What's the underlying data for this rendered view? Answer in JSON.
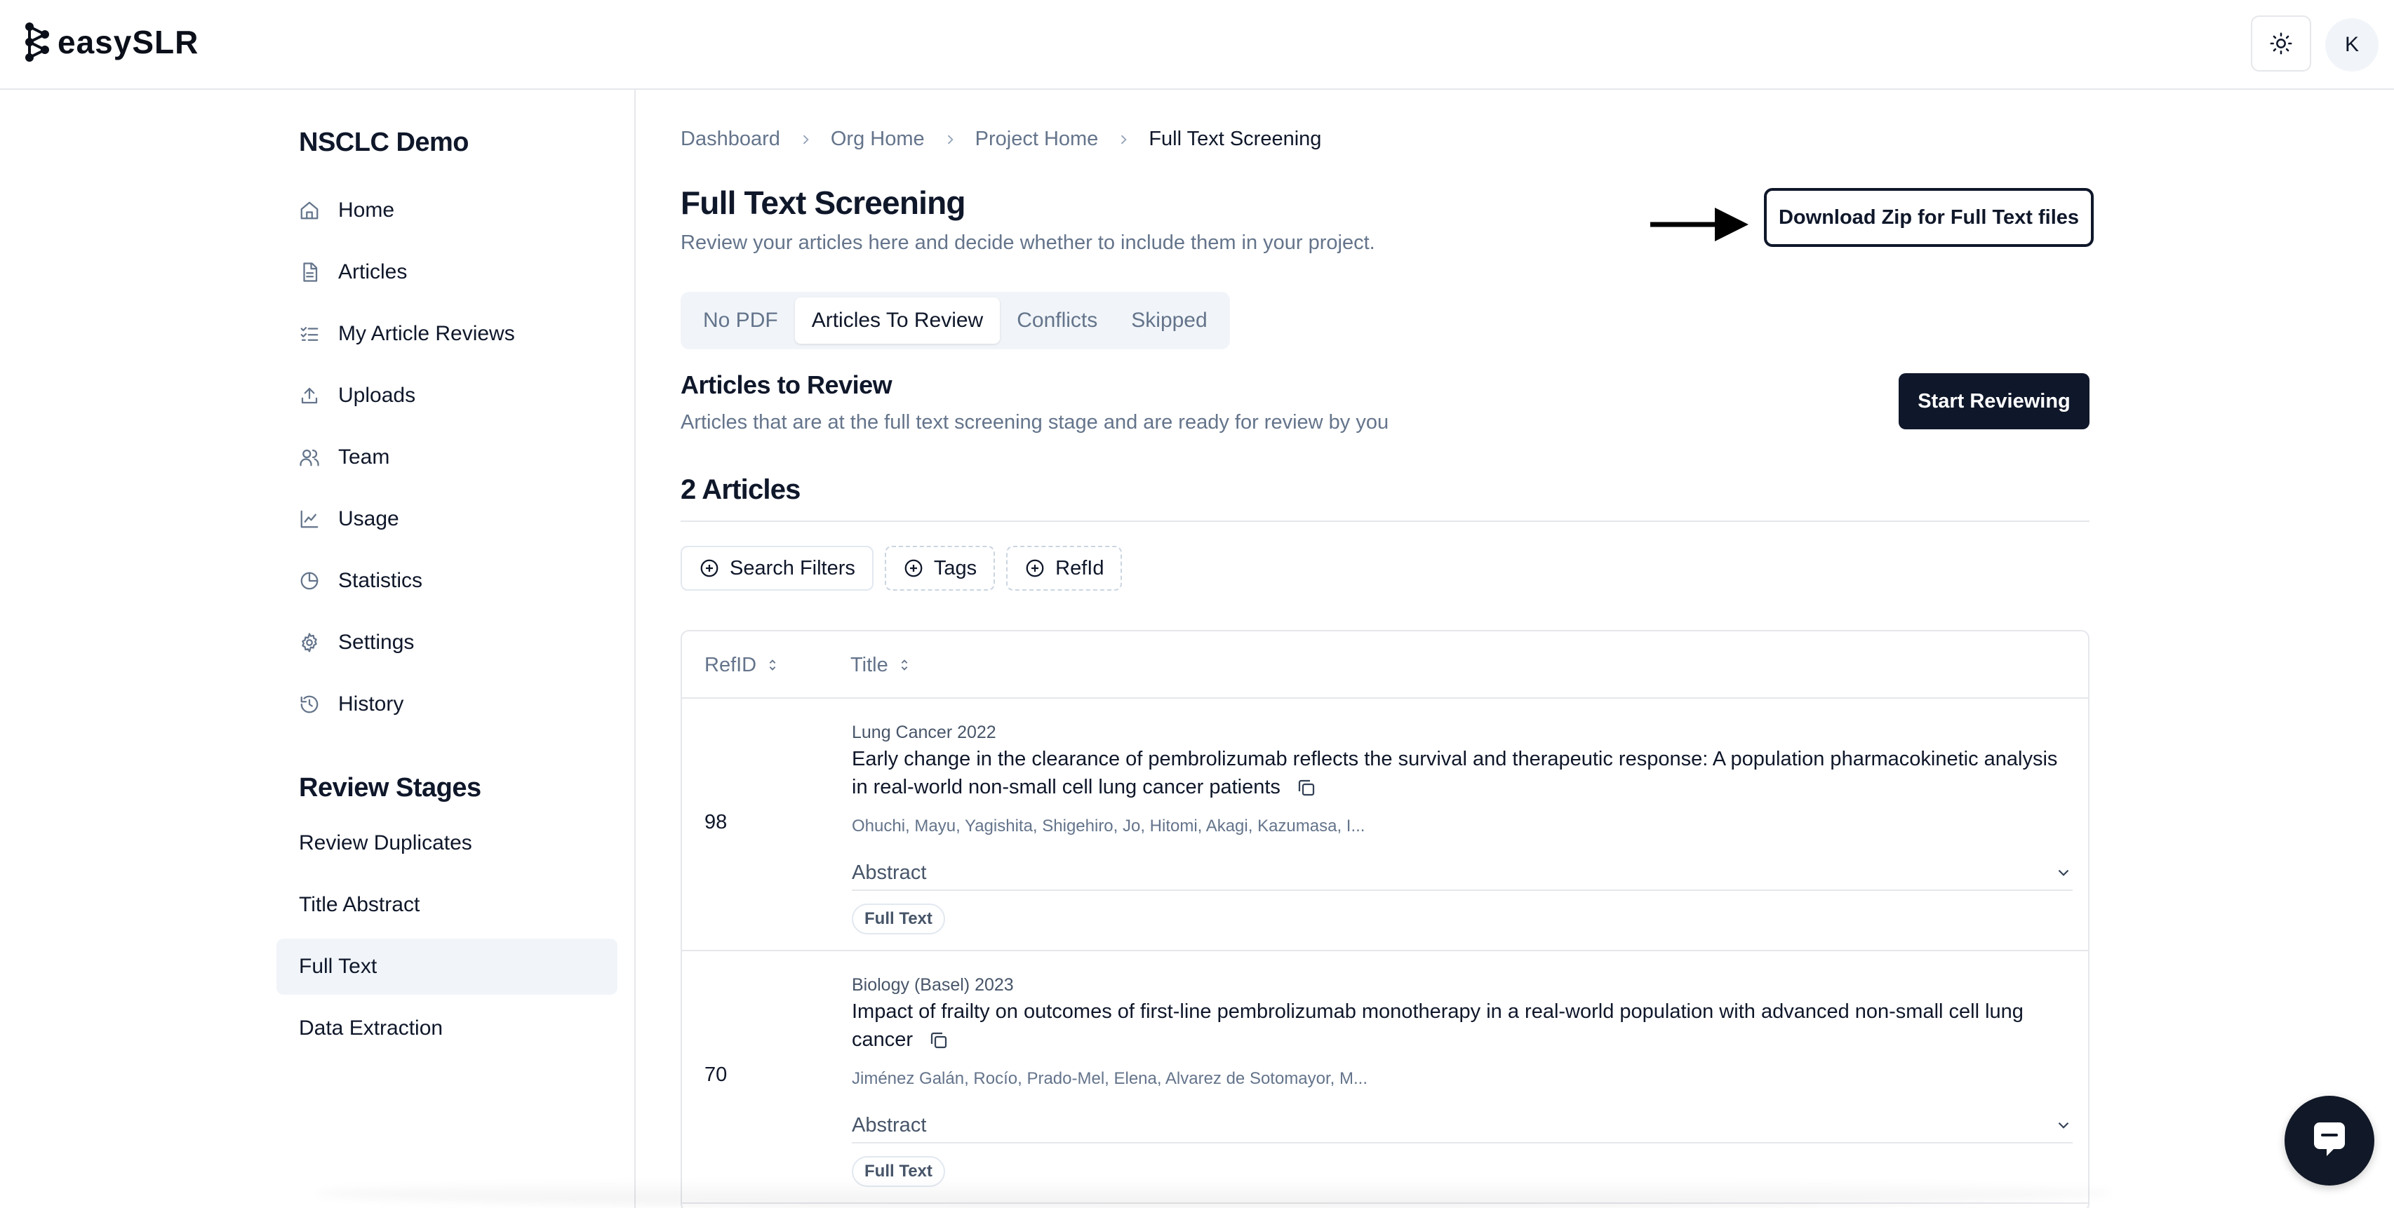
{
  "app": {
    "logo_text": "easySLR",
    "avatar_initial": "K"
  },
  "sidebar": {
    "project_name": "NSCLC Demo",
    "items": [
      {
        "label": "Home",
        "icon": "home-icon"
      },
      {
        "label": "Articles",
        "icon": "document-icon"
      },
      {
        "label": "My Article Reviews",
        "icon": "list-check-icon"
      },
      {
        "label": "Uploads",
        "icon": "upload-icon"
      },
      {
        "label": "Team",
        "icon": "users-icon"
      },
      {
        "label": "Usage",
        "icon": "line-chart-icon"
      },
      {
        "label": "Statistics",
        "icon": "pie-chart-icon"
      },
      {
        "label": "Settings",
        "icon": "gear-icon"
      },
      {
        "label": "History",
        "icon": "history-icon"
      }
    ],
    "stages_title": "Review Stages",
    "stages": [
      {
        "label": "Review Duplicates",
        "active": false
      },
      {
        "label": "Title Abstract",
        "active": false
      },
      {
        "label": "Full Text",
        "active": true
      },
      {
        "label": "Data Extraction",
        "active": false
      }
    ]
  },
  "breadcrumb": [
    "Dashboard",
    "Org Home",
    "Project Home",
    "Full Text Screening"
  ],
  "header": {
    "title": "Full Text Screening",
    "subtitle": "Review your articles here and decide whether to include them in your project.",
    "download_label": "Download Zip for Full Text files"
  },
  "tabs": [
    {
      "label": "No PDF",
      "active": false
    },
    {
      "label": "Articles To Review",
      "active": true
    },
    {
      "label": "Conflicts",
      "active": false
    },
    {
      "label": "Skipped",
      "active": false
    }
  ],
  "section": {
    "title": "Articles to Review",
    "subtitle": "Articles that are at the full text screening stage and are ready for review by you",
    "start_label": "Start Reviewing",
    "count_label": "2 Articles"
  },
  "filters": [
    "Search Filters",
    "Tags",
    "RefId"
  ],
  "table": {
    "columns": [
      "RefID",
      "Title"
    ],
    "rows": [
      {
        "refid": "98",
        "journal": "Lung Cancer 2022",
        "title": "Early change in the clearance of pembrolizumab reflects the survival and therapeutic response: A population pharmacokinetic analysis in real-world non-small cell lung cancer patients",
        "authors": "Ohuchi, Mayu, Yagishita, Shigehiro, Jo, Hitomi, Akagi, Kazumasa, I...",
        "abstract_label": "Abstract",
        "badge": "Full Text"
      },
      {
        "refid": "70",
        "journal": "Biology (Basel) 2023",
        "title": "Impact of frailty on outcomes of first-line pembrolizumab monotherapy in a real-world population with advanced non-small cell lung cancer",
        "authors": "Jiménez Galán, Rocío, Prado-Mel, Elena, Alvarez de Sotomayor, M...",
        "abstract_label": "Abstract",
        "badge": "Full Text"
      }
    ]
  },
  "colors": {
    "primary": "#0f172a",
    "muted": "#64748b",
    "border": "#e5e7eb",
    "active_bg": "#f1f5f9"
  }
}
